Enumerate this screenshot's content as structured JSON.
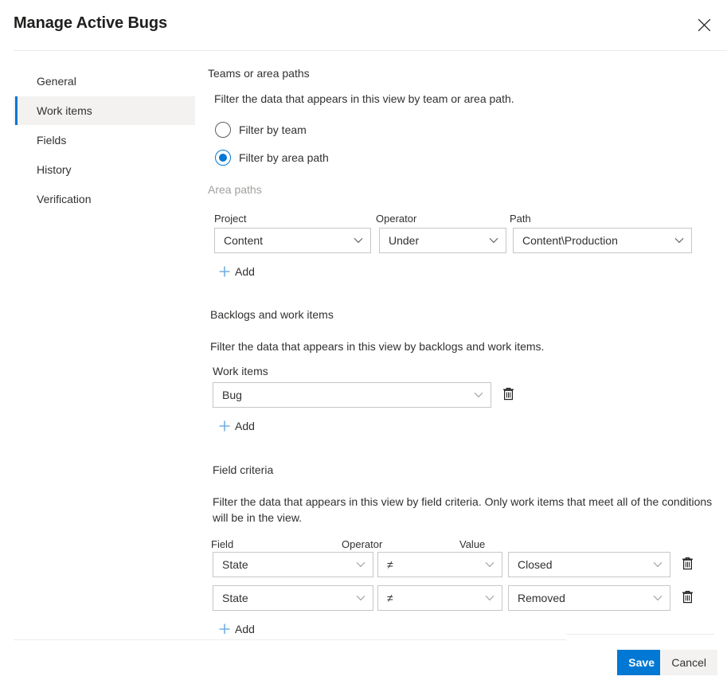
{
  "header": {
    "title": "Manage Active Bugs",
    "close_icon": "close-icon"
  },
  "sidebar": {
    "items": [
      {
        "label": "General",
        "selected": false
      },
      {
        "label": "Work items",
        "selected": true
      },
      {
        "label": "Fields",
        "selected": false
      },
      {
        "label": "History",
        "selected": false
      },
      {
        "label": "Verification",
        "selected": false
      }
    ]
  },
  "main": {
    "teams_section": {
      "title": "Teams or area paths",
      "description": "Filter the data that appears in this view by team or area path.",
      "options": [
        {
          "label": "Filter by team",
          "selected": false
        },
        {
          "label": "Filter by area path",
          "selected": true
        }
      ]
    },
    "area_paths": {
      "group_label": "Area paths",
      "columns": [
        "Project",
        "Operator",
        "Path"
      ],
      "rows": [
        {
          "project": "Content",
          "operator": "Under",
          "path": "Content\\Production"
        }
      ],
      "add_label": "Add"
    },
    "backlogs_section": {
      "title": "Backlogs and work items",
      "description": "Filter the data that appears in this view by backlogs and work items.",
      "field_label": "Work items",
      "rows": [
        {
          "value": "Bug"
        }
      ],
      "add_label": "Add",
      "delete_icon": "trash-icon"
    },
    "field_criteria": {
      "title": "Field criteria",
      "description": "Filter the data that appears in this view by field criteria. Only work items that meet all of the conditions will be in the view.",
      "columns": [
        "Field",
        "Operator",
        "Value"
      ],
      "rows": [
        {
          "field": "State",
          "operator": "≠",
          "value": "Closed"
        },
        {
          "field": "State",
          "operator": "≠",
          "value": "Removed"
        }
      ],
      "add_label": "Add",
      "delete_icon": "trash-icon"
    }
  },
  "footer": {
    "save_label": "Save",
    "cancel_label": "Cancel"
  },
  "colors": {
    "accent": "#0078d4",
    "selected_nav_bg": "#f3f2f1",
    "border": "#c8c6c4",
    "divider": "#edebe9",
    "add_icon": "#71afe5",
    "muted_text": "#a19f9d"
  }
}
